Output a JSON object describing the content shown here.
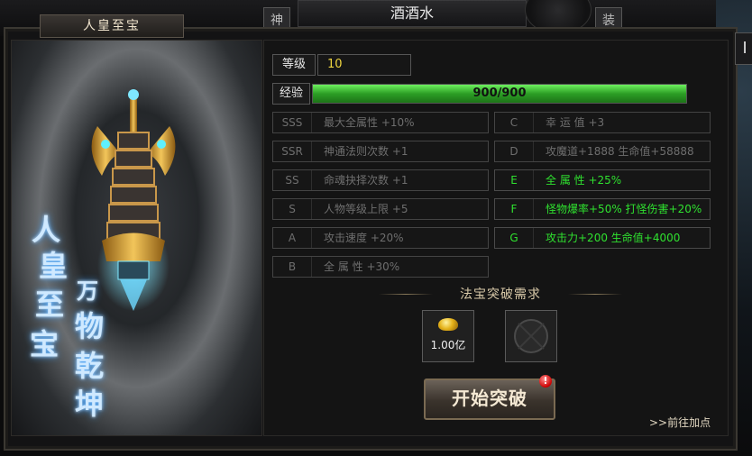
{
  "top_bar": {
    "player_name": "酒酒水",
    "tab_left": "神",
    "tab_right": "装"
  },
  "window": {
    "title": "人皇至宝",
    "close": "I"
  },
  "art": {
    "vertical_1": [
      "人",
      "皇",
      "至",
      "宝"
    ],
    "vertical_2": [
      "万",
      "物",
      "乾",
      "坤"
    ]
  },
  "level": {
    "label": "等级",
    "value": "10"
  },
  "experience": {
    "label": "经验",
    "text": "900/900",
    "fraction": 1.0
  },
  "stats_left": [
    {
      "key": "SSS",
      "value": "最大全属性 +10%"
    },
    {
      "key": "SSR",
      "value": "神通法则次数 +1"
    },
    {
      "key": "SS",
      "value": "命魂抉择次数 +1"
    },
    {
      "key": "S",
      "value": "人物等级上限 +5"
    },
    {
      "key": "A",
      "value": "攻击速度 +20%"
    },
    {
      "key": "B",
      "value": "全 属 性 +30%"
    }
  ],
  "stats_right": [
    {
      "key": "C",
      "value": "幸 运 值 +3",
      "active": false
    },
    {
      "key": "D",
      "value": "攻魔道+1888 生命值+58888",
      "active": false
    },
    {
      "key": "E",
      "value": "全 属 性 +25%",
      "active": true
    },
    {
      "key": "F",
      "value": "怪物爆率+50% 打怪伤害+20%",
      "active": true
    },
    {
      "key": "G",
      "value": "攻击力+200 生命值+4000",
      "active": true
    }
  ],
  "requirement": {
    "title": "法宝突破需求",
    "gold_amount": "1.00亿"
  },
  "buttons": {
    "break": "开始突破",
    "badge": "!",
    "goto": ">>前往加点"
  },
  "colors": {
    "active_stat": "#2fe12f",
    "inactive_stat": "#6e6e6e",
    "level_value": "#f0d640",
    "exp_fill": "#3fbf33"
  }
}
